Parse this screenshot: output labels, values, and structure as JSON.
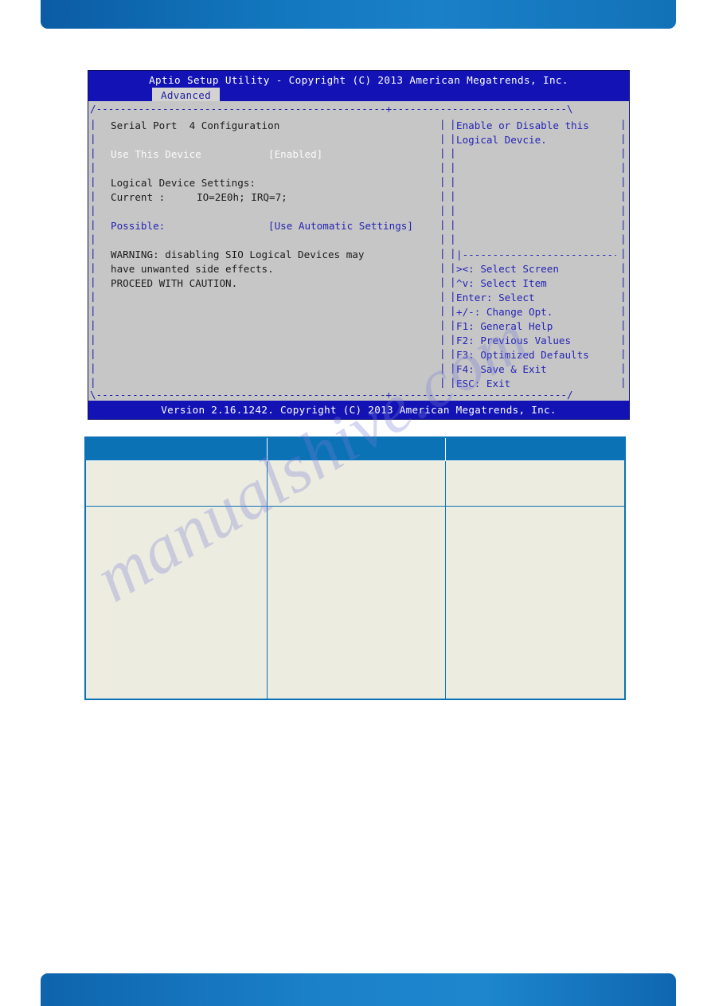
{
  "page": {
    "header_bar_color": "#1276bd",
    "footer_bar_color": "#1b82ca",
    "watermark_text": "manualshive.com"
  },
  "bios": {
    "title": "Aptio Setup Utility - Copyright (C) 2013 American Megatrends, Inc.",
    "active_tab": "Advanced",
    "footer": "Version 2.16.1242. Copyright (C) 2013 American Megatrends, Inc.",
    "frame_top": "/------------------------------------------------+-----------------------------\\",
    "frame_bottom": "\\------------------------------------------------+-----------------------------/",
    "left_bar_glyph": "|",
    "right_bar_glyph": "|",
    "help_separator": "|----------------------------|",
    "left_pane": {
      "section_title": "Serial Port  4 Configuration",
      "use_this_device_label": "Use This Device",
      "use_this_device_value": "[Enabled]",
      "logical_device_settings_label": "Logical Device Settings:",
      "current_label": "Current :",
      "current_value": "IO=2E0h; IRQ=7;",
      "possible_label": "Possible:",
      "possible_value": "[Use Automatic Settings]",
      "warning_line_1": "WARNING: disabling SIO Logical Devices may",
      "warning_line_2": "have unwanted side effects.",
      "warning_line_3": "PROCEED WITH CAUTION."
    },
    "help_pane": {
      "help_line_1": "Enable or Disable this",
      "help_line_2": "Logical Devcie.",
      "keys": [
        "><: Select Screen",
        "^v: Select Item",
        "Enter: Select",
        "+/-: Change Opt.",
        "F1: General Help",
        "F2: Previous Values",
        "F3: Optimized Defaults",
        "F4: Save & Exit",
        "ESC: Exit"
      ]
    }
  },
  "table": {
    "headers": [
      "",
      "",
      ""
    ],
    "rows": [
      [
        "",
        "",
        ""
      ],
      [
        "",
        "",
        ""
      ]
    ]
  }
}
